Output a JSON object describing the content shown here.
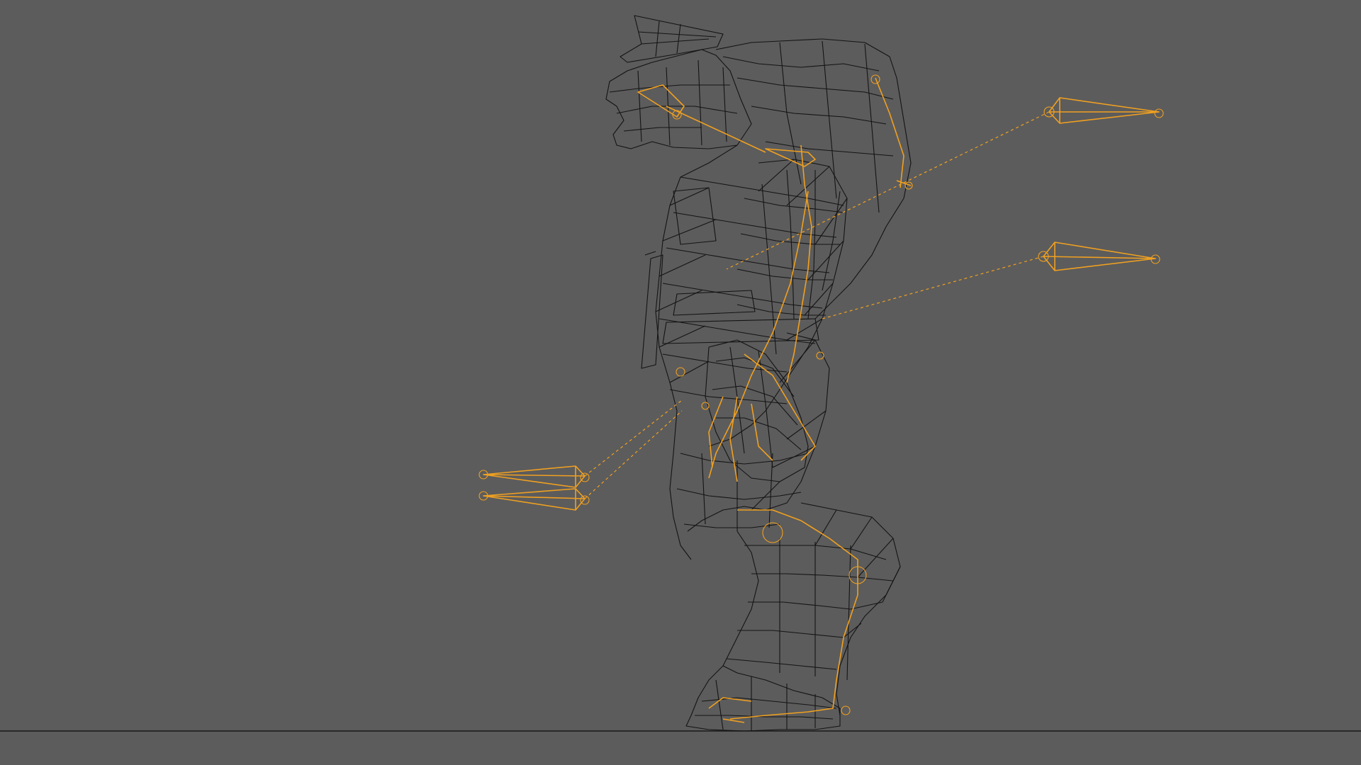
{
  "viewport": {
    "background_color": "#5c5c5c",
    "wireframe_color": "#141414",
    "rig_color": "#f0a020",
    "view": "side",
    "display_mode": "wireframe"
  },
  "scene": {
    "subject": "creature-character-mesh",
    "rig": {
      "ik_targets": [
        "hand-target-upper",
        "hand-target-lower",
        "foot-target-upper",
        "foot-target-lower"
      ]
    }
  }
}
